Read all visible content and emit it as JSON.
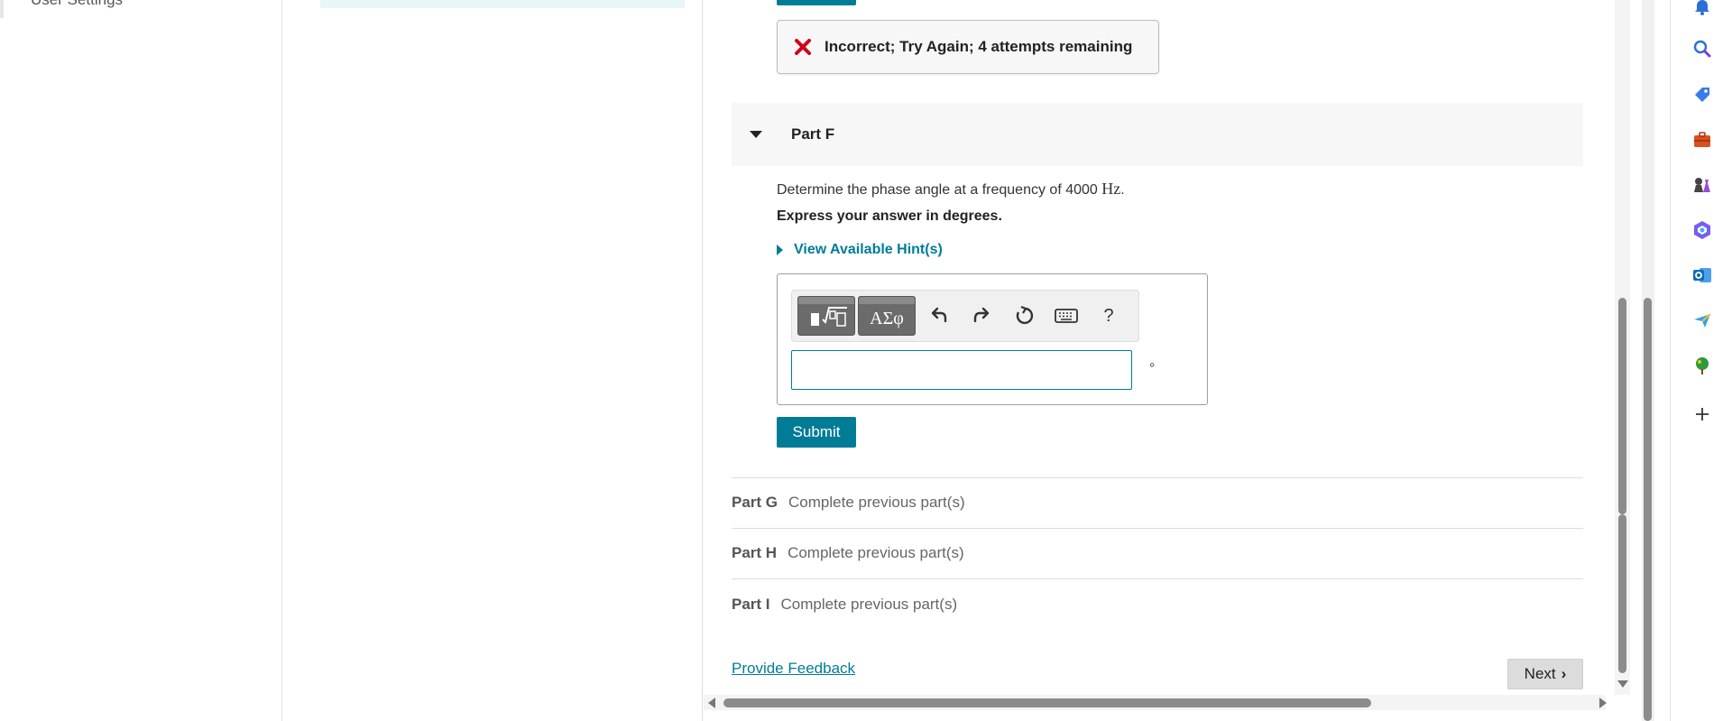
{
  "left_nav": {
    "user_settings": "User Settings"
  },
  "feedback": {
    "message": "Incorrect; Try Again; 4 attempts remaining",
    "icon": "x-icon",
    "icon_color": "#d0021b"
  },
  "part_f": {
    "title": "Part F",
    "question_prefix": "Determine the phase angle at a frequency of 4000 ",
    "question_unit": "Hz",
    "question_suffix": ".",
    "instruction": "Express your answer in degrees.",
    "hints_label": "View Available Hint(s)",
    "toolbar": {
      "symbols_label": "ΑΣφ",
      "help_label": "?"
    },
    "answer_value": "",
    "unit_symbol": "°",
    "submit_label": "Submit"
  },
  "parts": [
    {
      "name": "Part G",
      "status": "Complete previous part(s)"
    },
    {
      "name": "Part H",
      "status": "Complete previous part(s)"
    },
    {
      "name": "Part I",
      "status": "Complete previous part(s)"
    }
  ],
  "footer": {
    "provide_feedback": "Provide Feedback",
    "next_label": "Next"
  },
  "colors": {
    "accent": "#007c97",
    "error": "#d0021b"
  }
}
